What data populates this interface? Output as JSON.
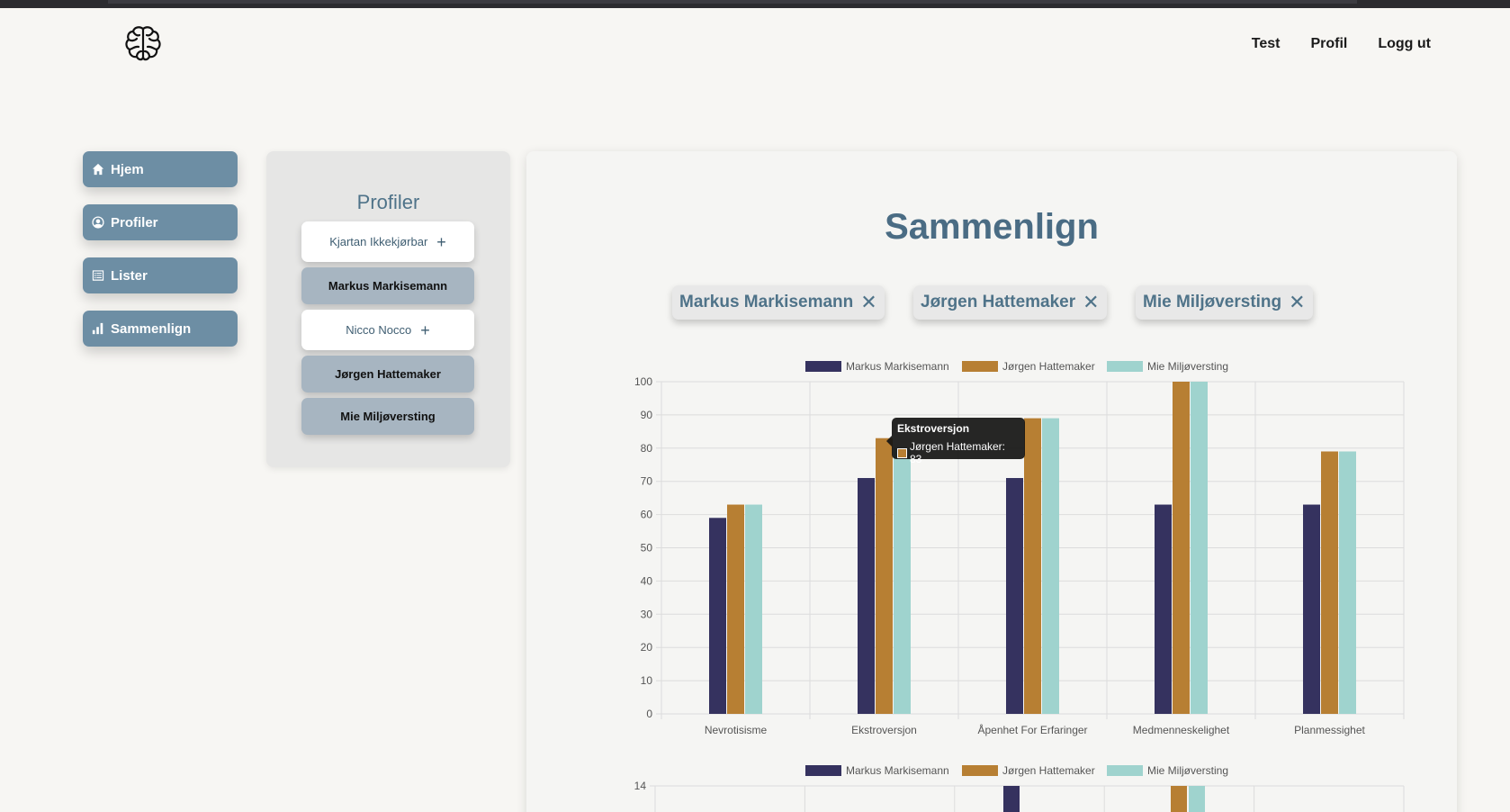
{
  "header": {
    "logo_icon": "brain-icon",
    "nav": [
      "Test",
      "Profil",
      "Logg ut"
    ]
  },
  "sidebar": {
    "items": [
      {
        "label": "Hjem",
        "icon": "home-icon"
      },
      {
        "label": "Profiler",
        "icon": "user-circle-icon"
      },
      {
        "label": "Lister",
        "icon": "list-icon"
      },
      {
        "label": "Sammenlign",
        "icon": "bar-chart-icon"
      }
    ]
  },
  "profiles_panel": {
    "title": "Profiler",
    "items": [
      {
        "name": "Kjartan Ikkekjørbar",
        "selected": false,
        "action": "+"
      },
      {
        "name": "Markus Markisemann",
        "selected": true
      },
      {
        "name": "Nicco Nocco",
        "selected": false,
        "action": "+"
      },
      {
        "name": "Jørgen Hattemaker",
        "selected": true
      },
      {
        "name": "Mie Miljøversting",
        "selected": true
      }
    ]
  },
  "main": {
    "title": "Sammenlign",
    "chips": [
      {
        "name": "Markus Markisemann",
        "remove": "✕"
      },
      {
        "name": "Jørgen Hattemaker",
        "remove": "✕"
      },
      {
        "name": "Mie Miljøversting",
        "remove": "✕"
      }
    ]
  },
  "colors": {
    "series1": "#35325f",
    "series2": "#b77f33",
    "series3": "#9fd3ce"
  },
  "tooltip": {
    "title": "Ekstroversjon",
    "text": "Jørgen Hattemaker: 83"
  },
  "chart_data": [
    {
      "type": "bar",
      "categories": [
        "Nevrotisisme",
        "Ekstroversjon",
        "Åpenhet For Erfaringer",
        "Medmenneskelighet",
        "Planmessighet"
      ],
      "series": [
        {
          "name": "Markus Markisemann",
          "values": [
            59,
            71,
            71,
            63,
            63
          ]
        },
        {
          "name": "Jørgen Hattemaker",
          "values": [
            63,
            83,
            89,
            100,
            79
          ]
        },
        {
          "name": "Mie Miljøversting",
          "values": [
            63,
            80,
            89,
            100,
            79
          ]
        }
      ],
      "ylim": [
        0,
        100
      ],
      "yticks": [
        0,
        10,
        20,
        30,
        40,
        50,
        60,
        70,
        80,
        90,
        100
      ],
      "grid": true,
      "legend": "top"
    },
    {
      "type": "bar",
      "categories": [],
      "series": [
        {
          "name": "Markus Markisemann",
          "values": []
        },
        {
          "name": "Jørgen Hattemaker",
          "values": []
        },
        {
          "name": "Mie Miljøversting",
          "values": []
        }
      ],
      "yticks": [
        14
      ],
      "grid": true,
      "legend": "top"
    }
  ]
}
